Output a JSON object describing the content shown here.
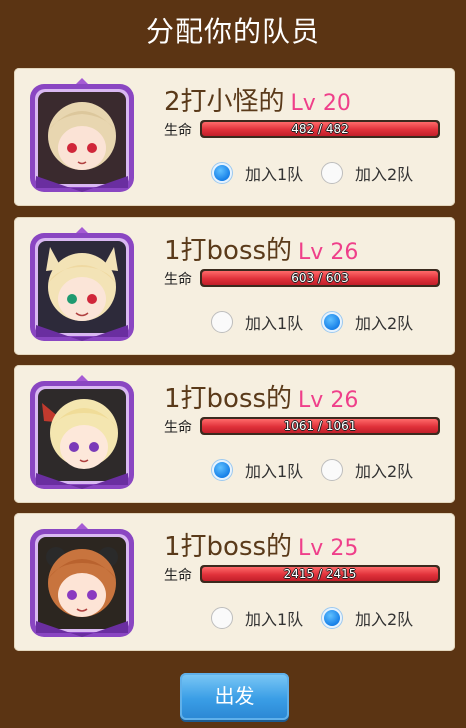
{
  "title": "分配你的队员",
  "hp_label": "生命",
  "team_options": [
    "加入1队",
    "加入2队"
  ],
  "members": [
    {
      "name": "2打小怪的",
      "level": "Lv 20",
      "hp": "482 / 482",
      "hp_fraction": 1.0,
      "team": 1
    },
    {
      "name": "1打boss的",
      "level": "Lv 26",
      "hp": "603 / 603",
      "hp_fraction": 1.0,
      "team": 2
    },
    {
      "name": "1打boss的",
      "level": "Lv 26",
      "hp": "1061 / 1061",
      "hp_fraction": 1.0,
      "team": 1
    },
    {
      "name": "1打boss的",
      "level": "Lv 25",
      "hp": "2415 / 2415",
      "hp_fraction": 1.0,
      "team": 2
    }
  ],
  "start_button": "出发",
  "colors": {
    "background": "#5b3413",
    "card": "#f6efe0",
    "level": "#ef3f8a",
    "hp_bar": "#e0313a",
    "radio_selected": "#1780e8",
    "button": "#3a9ee6"
  }
}
